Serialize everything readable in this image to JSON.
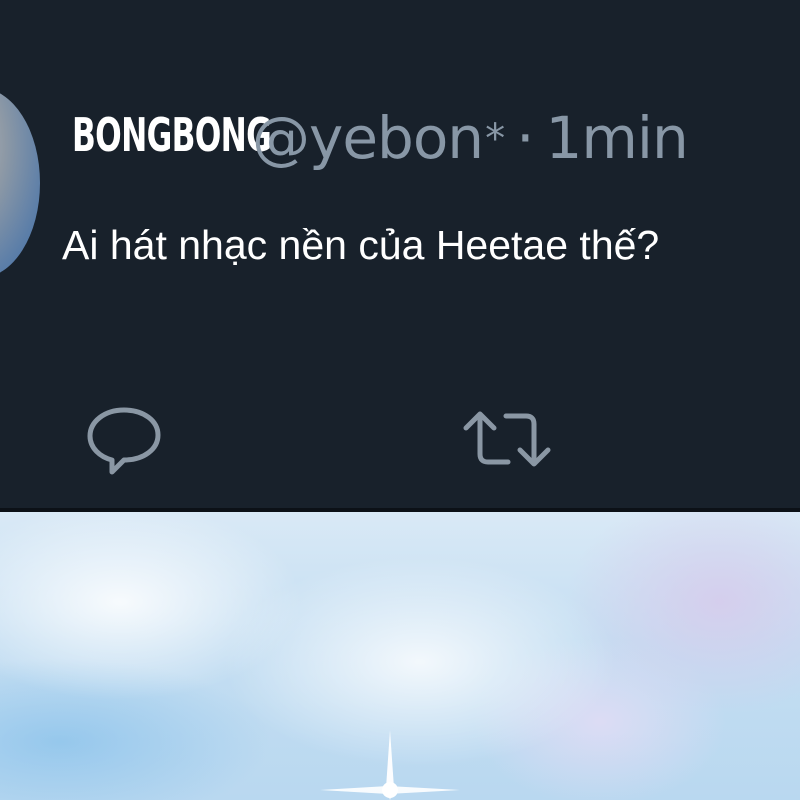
{
  "tweet": {
    "display_name": "BONGBONG",
    "handle": "@yebon",
    "handle_mark": "*",
    "separator": "·",
    "time": "1min",
    "text": "Ai hát nhạc nền của Heetae thế?"
  },
  "actions": {
    "reply_icon": "reply-icon",
    "retweet_icon": "retweet-icon"
  },
  "colors": {
    "card_background": "#18212b",
    "meta_text": "#8897a6",
    "primary_text": "#ffffff",
    "icon": "#8a97a4"
  }
}
